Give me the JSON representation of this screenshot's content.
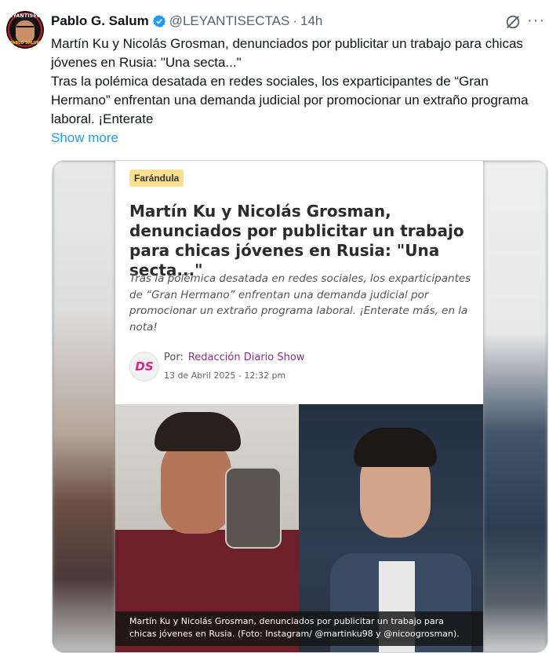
{
  "user": {
    "name": "Pablo G. Salum",
    "handle": "@LEYANTISECTAS",
    "separator": "·",
    "time": "14h",
    "avatar_top_text": "LEYANTISECTAS",
    "avatar_bottom_text": "PABLO SALUM"
  },
  "tweet": {
    "line1": "Martín Ku y Nicolás Grosman, denunciados por publicitar un trabajo para chicas jóvenes en Rusia: \"Una secta...\"",
    "line2": "Tras la polémica desatada en redes sociales, los exparticipantes de “Gran Hermano” enfrentan una demanda judicial por promocionar un extraño programa laboral. ¡Enterate",
    "show_more": "Show more"
  },
  "article": {
    "tag": "Farándula",
    "title": "Martín Ku y Nicolás Grosman, denunciados por publicitar un trabajo para chicas jóvenes en Rusia: \"Una secta...\"",
    "summary": "Tras la polémica desatada en redes sociales, los exparticipantes de “Gran Hermano” enfrentan una demanda judicial por promocionar un extraño programa laboral. ¡Enterate más, en la nota!",
    "logo_text_a": "D",
    "logo_text_b": "S",
    "by_label": "Por:",
    "author": "Redacción Diario Show",
    "date": "13 de Abril 2025 - 12:32 pm",
    "caption": "Martín Ku y Nicolás Grosman, denunciados por publicitar un trabajo para chicas jóvenes en Rusia. (Foto: Instagram/ @martinku98 y @nicoogrosman)."
  },
  "colors": {
    "link": "#1d9bf0",
    "verified": "#1d9bf0",
    "tag_bg": "#fbe08f",
    "author": "#8a2d8c"
  },
  "icons": [
    "verified-badge-icon",
    "grok-icon",
    "more-options-icon"
  ]
}
